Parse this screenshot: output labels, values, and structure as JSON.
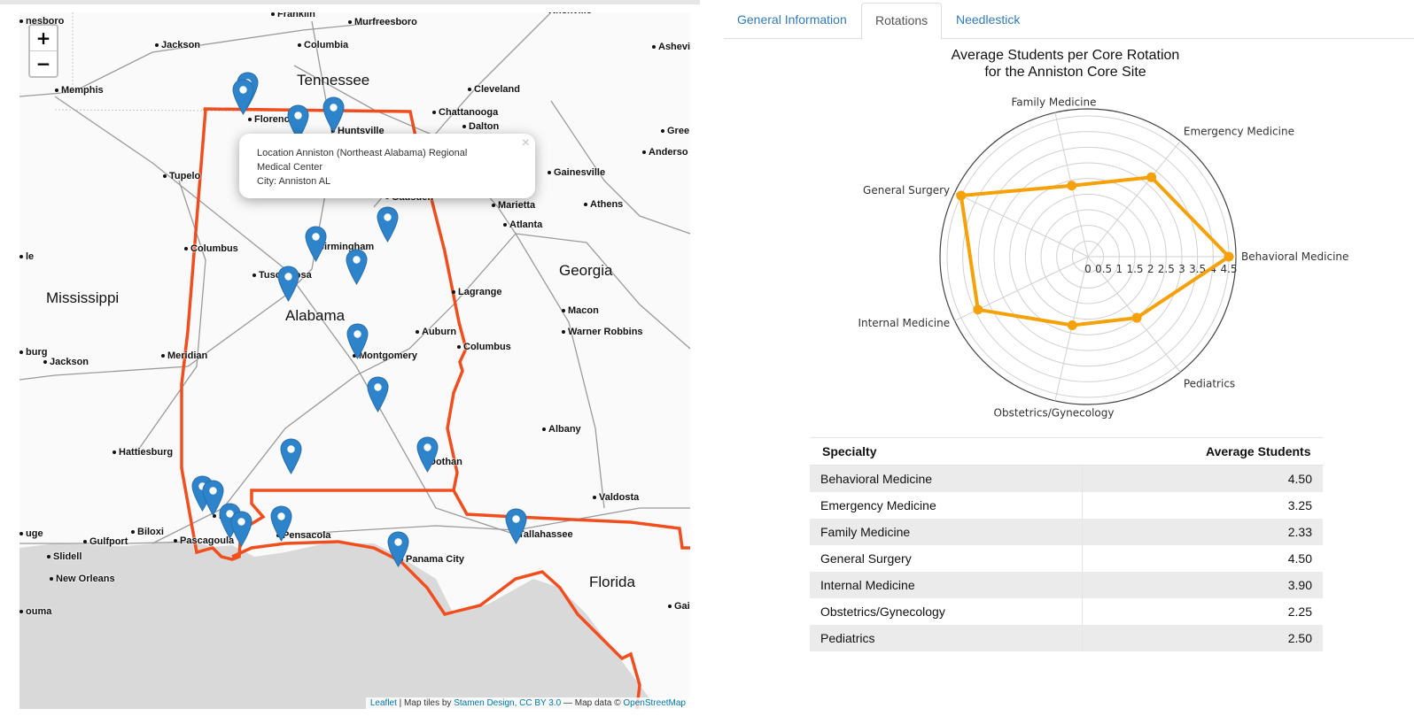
{
  "map": {
    "zoom_in": "+",
    "zoom_out": "−",
    "cities": [
      {
        "name": "Franklin"
      },
      {
        "name": "Murfreesboro"
      },
      {
        "name": "Knoxville"
      },
      {
        "name": "Jackson"
      },
      {
        "name": "Columbia"
      },
      {
        "name": "Ashevil"
      },
      {
        "name": "Memphis"
      },
      {
        "name": "Cleveland"
      },
      {
        "name": "Chattanooga"
      },
      {
        "name": "Dalton"
      },
      {
        "name": "Florence"
      },
      {
        "name": "Huntsville"
      },
      {
        "name": "Gree"
      },
      {
        "name": "Anderso"
      },
      {
        "name": "Tupelo"
      },
      {
        "name": "Gainesville"
      },
      {
        "name": "Marietta"
      },
      {
        "name": "Athens"
      },
      {
        "name": "Atlanta"
      },
      {
        "name": "Gadsden"
      },
      {
        "name": "Birmingham"
      },
      {
        "name": "Columbus"
      },
      {
        "name": "Tuscaloosa"
      },
      {
        "name": "Lagrange"
      },
      {
        "name": "Macon"
      },
      {
        "name": "Warner Robbins"
      },
      {
        "name": "Auburn"
      },
      {
        "name": "Columbus"
      },
      {
        "name": "Jackson"
      },
      {
        "name": "Meridian"
      },
      {
        "name": "Montgomery"
      },
      {
        "name": "Albany"
      },
      {
        "name": "Hattiesburg"
      },
      {
        "name": "Dothan"
      },
      {
        "name": "Valdosta"
      },
      {
        "name": "Biloxi"
      },
      {
        "name": "Gulfport"
      },
      {
        "name": "Pascagoula"
      },
      {
        "name": "Pensacola"
      },
      {
        "name": "Tallahassee"
      },
      {
        "name": "Slidell"
      },
      {
        "name": "Panama City"
      },
      {
        "name": "New Orleans"
      },
      {
        "name": "Mobile"
      },
      {
        "name": "burg"
      },
      {
        "name": "uge"
      },
      {
        "name": "ouma"
      },
      {
        "name": "Gai"
      },
      {
        "name": "le"
      },
      {
        "name": "nesboro"
      }
    ],
    "regions": [
      "Tennessee",
      "Mississippi",
      "Alabama",
      "Georgia",
      "Florida"
    ],
    "popup": {
      "line1": "Location Anniston (Northeast Alabama) Regional",
      "line2": "Medical Center",
      "line3": "City: Anniston AL",
      "close": "×"
    },
    "attribution": {
      "leaflet": "Leaflet",
      "sep1": " | Map tiles by ",
      "stamen": "Stamen Design, CC BY 3.0",
      "sep2": " — Map data © ",
      "osm": "OpenStreetMap"
    },
    "colors": {
      "state_outline": "#f04e1e",
      "marker": "#2e84cb",
      "water": "#d9d9d9"
    }
  },
  "tabs": [
    {
      "label": "General Information",
      "active": false
    },
    {
      "label": "Rotations",
      "active": true
    },
    {
      "label": "Needlestick",
      "active": false
    }
  ],
  "chart_data": {
    "type": "radar",
    "title_line1": "Average Students per Core Rotation",
    "title_line2": "for the Anniston Core Site",
    "categories": [
      "Behavioral Medicine",
      "Emergency Medicine",
      "Family Medicine",
      "General Surgery",
      "Internal Medicine",
      "Obstetrics/Gynecology",
      "Pediatrics"
    ],
    "values": [
      4.5,
      3.25,
      2.33,
      4.5,
      3.9,
      2.25,
      2.5
    ],
    "r_ticks": [
      "0",
      "0.5",
      "1",
      "1.5",
      "2",
      "2.5",
      "3",
      "3.5",
      "4",
      "4.5"
    ],
    "rmax": 4.5,
    "color": "#f5a20a"
  },
  "table": {
    "headers": [
      "Specialty",
      "Average Students"
    ],
    "rows": [
      [
        "Behavioral Medicine",
        "4.50"
      ],
      [
        "Emergency Medicine",
        "3.25"
      ],
      [
        "Family Medicine",
        "2.33"
      ],
      [
        "General Surgery",
        "4.50"
      ],
      [
        "Internal Medicine",
        "3.90"
      ],
      [
        "Obstetrics/Gynecology",
        "2.25"
      ],
      [
        "Pediatrics",
        "2.50"
      ]
    ]
  }
}
